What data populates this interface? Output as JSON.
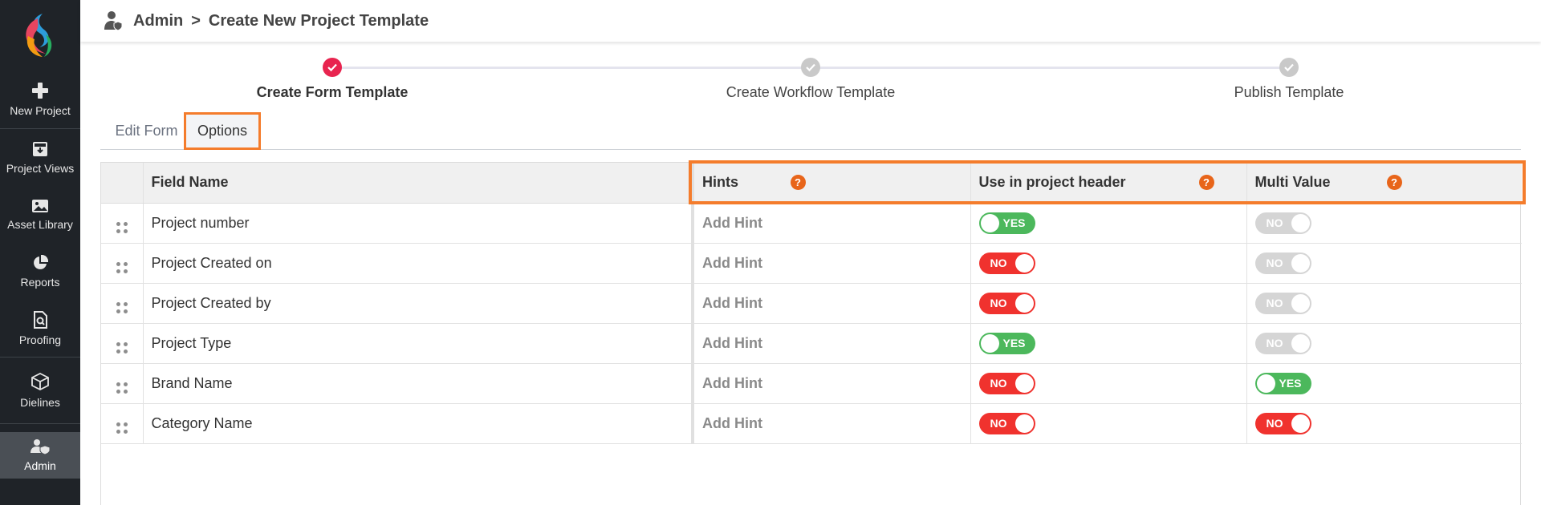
{
  "sidebar": {
    "items": [
      {
        "label": "New Project",
        "icon": "plus-icon"
      },
      {
        "label": "Project Views",
        "icon": "inbox-download-icon"
      },
      {
        "label": "Asset Library",
        "icon": "image-icon"
      },
      {
        "label": "Reports",
        "icon": "pie-chart-icon"
      },
      {
        "label": "Proofing",
        "icon": "document-search-icon"
      },
      {
        "label": "Dielines",
        "icon": "box-3d-icon"
      },
      {
        "label": "Admin",
        "icon": "user-shield-icon"
      }
    ]
  },
  "header": {
    "section": "Admin",
    "separator": ">",
    "page": "Create New Project Template"
  },
  "stepper": {
    "steps": [
      {
        "label": "Create Form Template",
        "state": "done"
      },
      {
        "label": "Create Workflow Template",
        "state": "pending"
      },
      {
        "label": "Publish Template",
        "state": "pending"
      }
    ]
  },
  "tabs": {
    "edit_form": "Edit Form",
    "options": "Options"
  },
  "table": {
    "columns": {
      "field_name": "Field Name",
      "hints": "Hints",
      "use_in_header": "Use in project header",
      "multi_value": "Multi Value"
    },
    "help_glyph": "?",
    "rows": [
      {
        "field": "Project number",
        "hint": "Add Hint",
        "header": "YES",
        "multi": "NO",
        "multi_enabled": false
      },
      {
        "field": "Project Created on",
        "hint": "Add Hint",
        "header": "NO",
        "multi": "NO",
        "multi_enabled": false
      },
      {
        "field": "Project Created by",
        "hint": "Add Hint",
        "header": "NO",
        "multi": "NO",
        "multi_enabled": false
      },
      {
        "field": "Project Type",
        "hint": "Add Hint",
        "header": "YES",
        "multi": "NO",
        "multi_enabled": false
      },
      {
        "field": "Brand Name",
        "hint": "Add Hint",
        "header": "NO",
        "multi": "YES",
        "multi_enabled": true
      },
      {
        "field": "Category Name",
        "hint": "Add Hint",
        "header": "NO",
        "multi": "NO",
        "multi_enabled": true
      }
    ]
  },
  "colors": {
    "sidebar_bg": "#1f2328",
    "highlight": "#f47c2c",
    "step_done": "#e8244f",
    "toggle_yes": "#4cb85c",
    "toggle_no": "#f0322e",
    "toggle_disabled": "#d5d5d5",
    "help_icon": "#e8651a"
  }
}
